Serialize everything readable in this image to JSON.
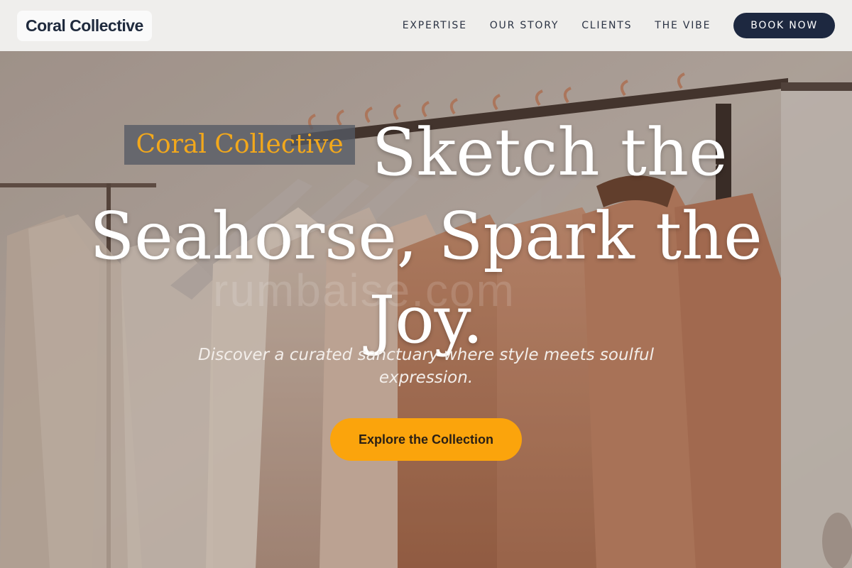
{
  "header": {
    "logo": "Coral Collective",
    "nav": [
      "EXPERTISE",
      "OUR STORY",
      "CLIENTS",
      "THE VIBE"
    ],
    "cta": "BOOK NOW"
  },
  "hero": {
    "brand_tag": "Coral Collective",
    "headline_line1": "Sketch the",
    "headline_line2": "Seahorse, Spark the",
    "headline_line3": "Joy.",
    "subtitle": "Discover a curated sanctuary where style meets soulful expression.",
    "cta": "Explore the Collection",
    "watermark": "rumbaise.com"
  },
  "colors": {
    "header_bg": "#efeeec",
    "book_button": "#1d2840",
    "accent": "#fba40c",
    "brand_tag_text": "#f2a81c"
  }
}
